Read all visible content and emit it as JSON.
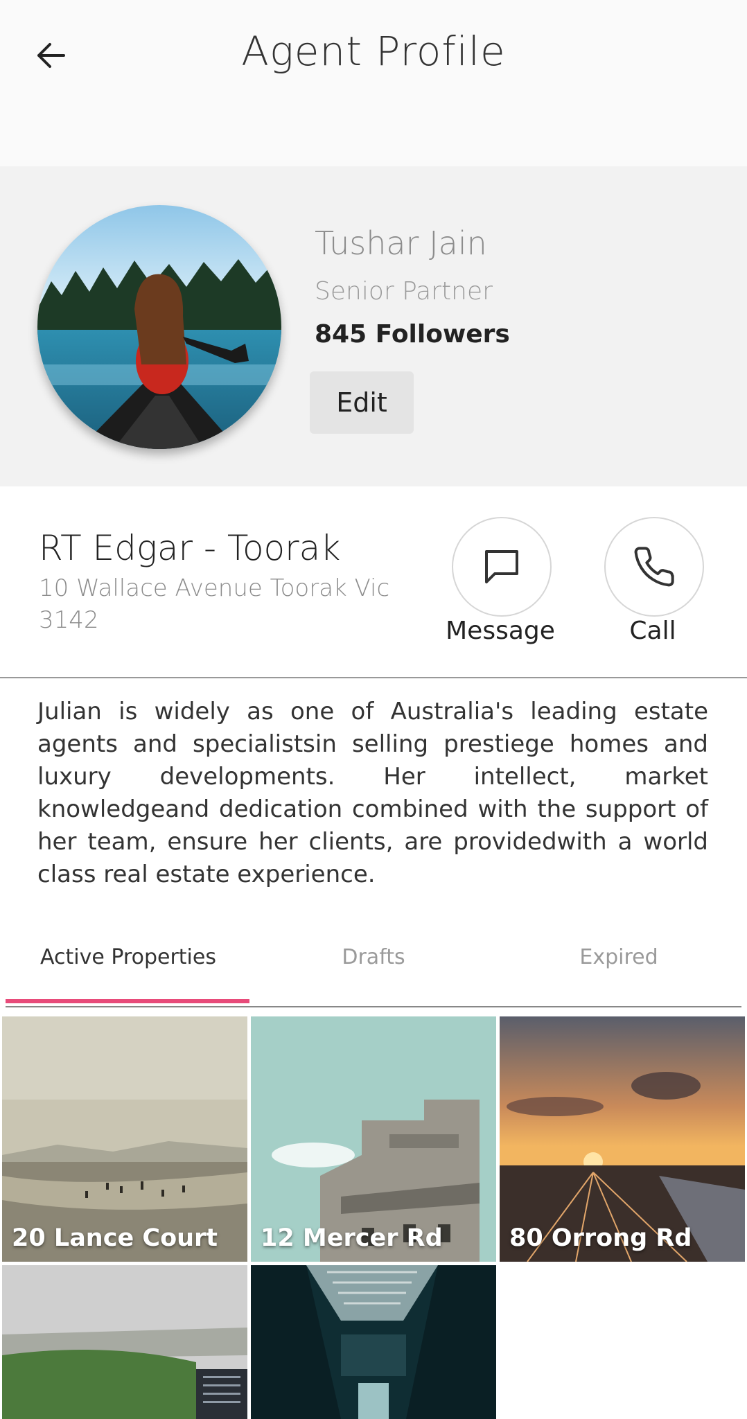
{
  "header": {
    "title": "Agent Profile",
    "back_icon": "arrow-left-icon"
  },
  "profile": {
    "name": "Tushar Jain",
    "role": "Senior Partner",
    "followers": "845 Followers",
    "edit_label": "Edit"
  },
  "office": {
    "name": "RT Edgar - Toorak",
    "address": "10 Wallace Avenue Toorak Vic 3142"
  },
  "actions": {
    "message_label": "Message",
    "message_icon": "chat-bubble-icon",
    "call_label": "Call",
    "call_icon": "phone-icon"
  },
  "bio": "Julian is widely as one of Australia's leading estate agents and specialistsin selling prestiege homes and luxury developments. Her intellect, market knowledgeand dedication combined with the support of her team, ensure her clients, are providedwith a world class real estate experience.",
  "tabs": [
    {
      "label": "Active Properties",
      "active": true
    },
    {
      "label": "Drafts",
      "active": false
    },
    {
      "label": "Expired",
      "active": false
    }
  ],
  "properties": [
    {
      "label": "20 Lance Court"
    },
    {
      "label": "12 Mercer Rd"
    },
    {
      "label": "80 Orrong Rd"
    },
    {
      "label": ""
    },
    {
      "label": ""
    }
  ],
  "colors": {
    "accent": "#e84b7a",
    "profile_bg": "#f2f2f2"
  }
}
